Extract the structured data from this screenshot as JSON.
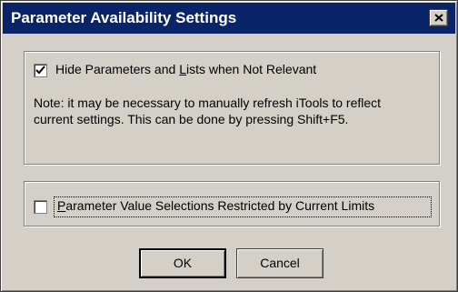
{
  "window": {
    "title": "Parameter Availability Settings"
  },
  "hide_params": {
    "checked": true,
    "label_pre": "Hide Parameters and ",
    "label_accel": "L",
    "label_post": "ists when Not Relevant"
  },
  "note": {
    "text": "Note:  it may be necessary to manually refresh iTools to reflect current settings.  This can be done by pressing Shift+F5."
  },
  "restrict_values": {
    "checked": false,
    "label_accel": "P",
    "label_post": "arameter Value Selections Restricted by Current Limits"
  },
  "buttons": {
    "ok": "OK",
    "cancel": "Cancel"
  },
  "icons": {
    "close": "close-icon",
    "check": "checkmark-icon"
  }
}
